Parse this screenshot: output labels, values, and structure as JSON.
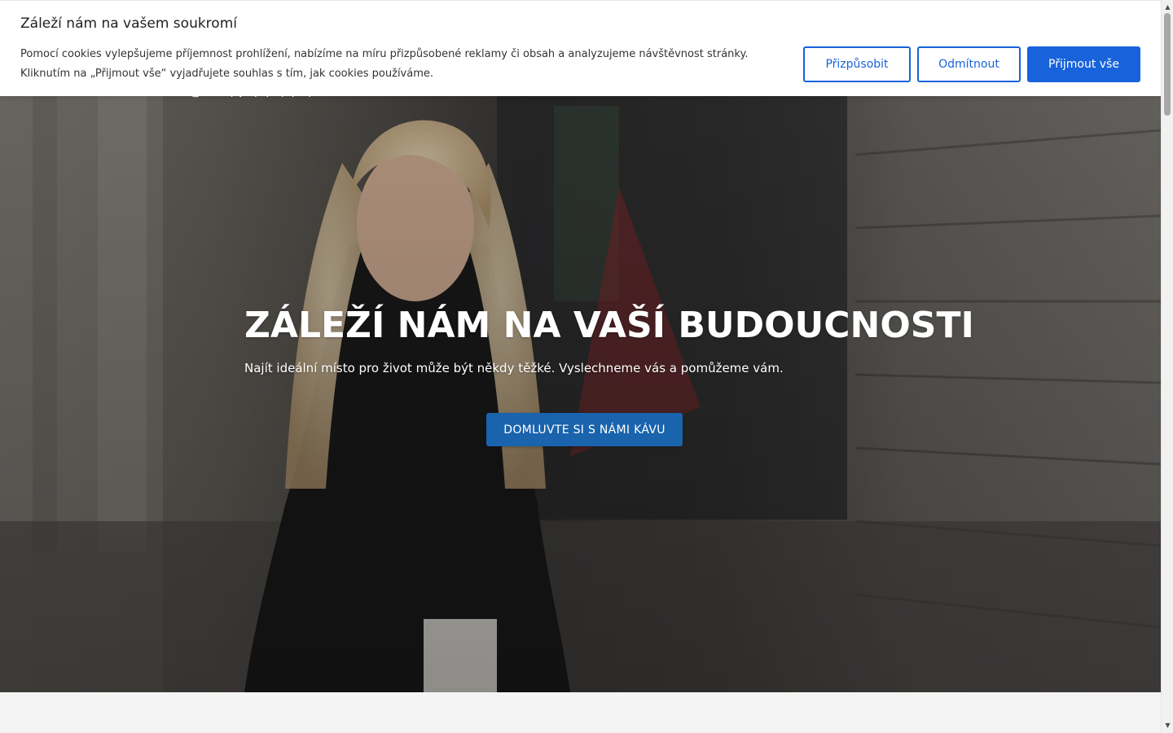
{
  "cookie_banner": {
    "title": "Záleží nám na vašem soukromí",
    "text": "Pomocí cookies vylepšujeme příjemnost prohlížení, nabízíme na míru přizpůsobené reklamy či obsah a analyzujeme návštěvnost stránky. Kliknutím na „Přijmout vše“ vyjadřujete souhlas s tím, jak cookies používáme.",
    "customize_label": "Přizpůsobit",
    "reject_label": "Odmítnout",
    "accept_label": "Přijmout vše",
    "accent_color": "#1863dc"
  },
  "hero": {
    "logo_fragment": "S NÁMI",
    "title": "ZÁLEŽÍ NÁM NA VAŠÍ BUDOUCNOSTI",
    "subtitle": "Najít ideální místo pro život může být někdy těžké. Vyslechneme vás a pomůžeme vám.",
    "cta_label": "DOMLUVTE SI S NÁMI KÁVU",
    "cta_color": "#1a63ad"
  },
  "scrollbar": {
    "up_icon": "triangle-up-icon",
    "down_icon": "triangle-down-icon"
  }
}
